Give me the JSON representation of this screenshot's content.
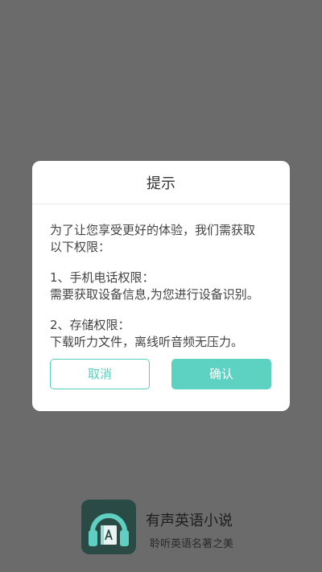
{
  "dialog": {
    "title": "提示",
    "intro_line1": "为了让您享受更好的体验，我们需获取",
    "intro_line2": "以下权限：",
    "perm1_title": "1、手机电话权限：",
    "perm1_desc": "需要获取设备信息,为您进行设备识别。",
    "perm2_title": "2、存储权限：",
    "perm2_desc": "下载听力文件，离线听音频无压力。",
    "cancel_label": "取消",
    "confirm_label": "确认"
  },
  "app": {
    "name": "有声英语小说",
    "slogan": "聆听英语名著之美",
    "logo_icon": "headphones-book-icon"
  },
  "colors": {
    "accent": "#5dd1c2",
    "overlay": "#6b6b6b",
    "logo_bg": "#2a4a46"
  }
}
